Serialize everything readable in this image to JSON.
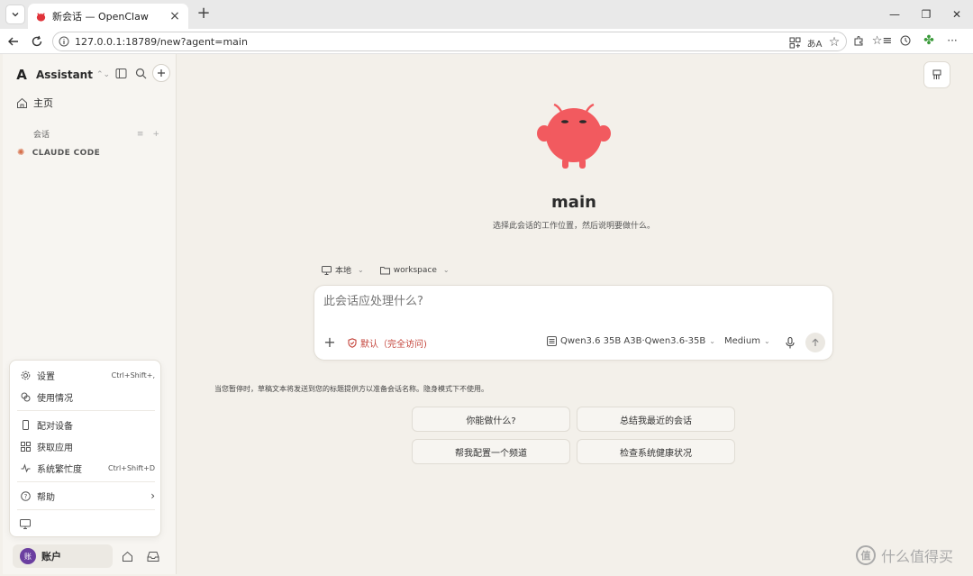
{
  "browser": {
    "tab_title": "新会话 — OpenClaw",
    "url": "127.0.0.1:18789/new?agent=main"
  },
  "sidebar": {
    "avatar_letter": "A",
    "assistant_name": "Assistant",
    "home_label": "主页",
    "section_label": "会话",
    "project_label": "CLAUDE CODE",
    "user_avatar_letter": "账",
    "user_name": "账户"
  },
  "menu": {
    "settings": "设置",
    "settings_shortcut": "Ctrl+Shift+,",
    "usage": "使用情况",
    "pair_device": "配对设备",
    "get_apps": "获取应用",
    "system_busy": "系统繁忙度",
    "system_busy_shortcut": "Ctrl+Shift+D",
    "help": "帮助"
  },
  "main": {
    "agent_name": "main",
    "hint": "选择此会话的工作位置，然后说明要做什么。",
    "location_label": "本地",
    "workspace_label": "workspace",
    "composer_placeholder": "此会话应处理什么?",
    "permission_label": "默认（完全访问)",
    "model_label": "Qwen3.6 35B A3B·Qwen3.6-35B",
    "effort_label": "Medium",
    "notice": "当您暂停时，草稿文本将发送到您的标题提供方以准备会话名称。隐身模式下不使用。",
    "suggestions": [
      "你能做什么?",
      "总结我最近的会话",
      "帮我配置一个频道",
      "检查系统健康状况"
    ]
  },
  "colors": {
    "mascot": "#f25a5f",
    "permission": "#c4453c",
    "user_avatar": "#6b3fa0"
  },
  "watermark": "什么值得买"
}
